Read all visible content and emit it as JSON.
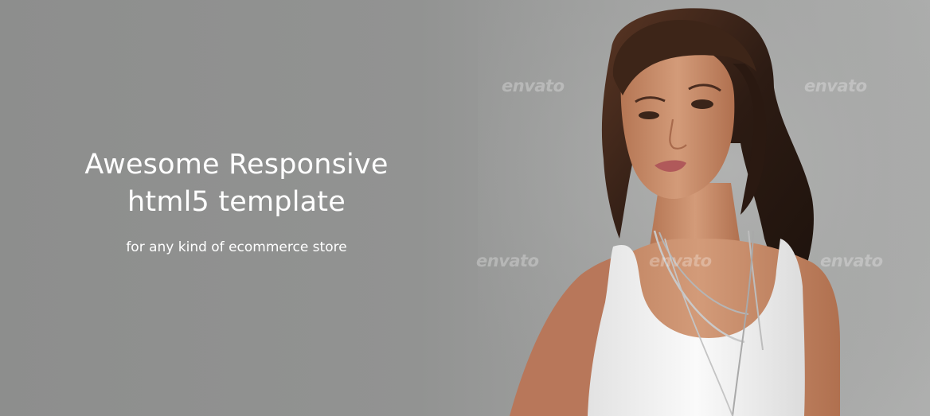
{
  "slider": {
    "headline_line1": "Awesome Responsive",
    "headline_line2": "html5 template",
    "subtitle": "for any kind of ecommerce store",
    "watermark": "envato",
    "image": "model-photo"
  },
  "colors": {
    "background": "#939493",
    "caption_text": "#ffffff",
    "shirt": "#f4f4f4",
    "hair": "#2e1d15",
    "skin": "#c98d6b"
  }
}
